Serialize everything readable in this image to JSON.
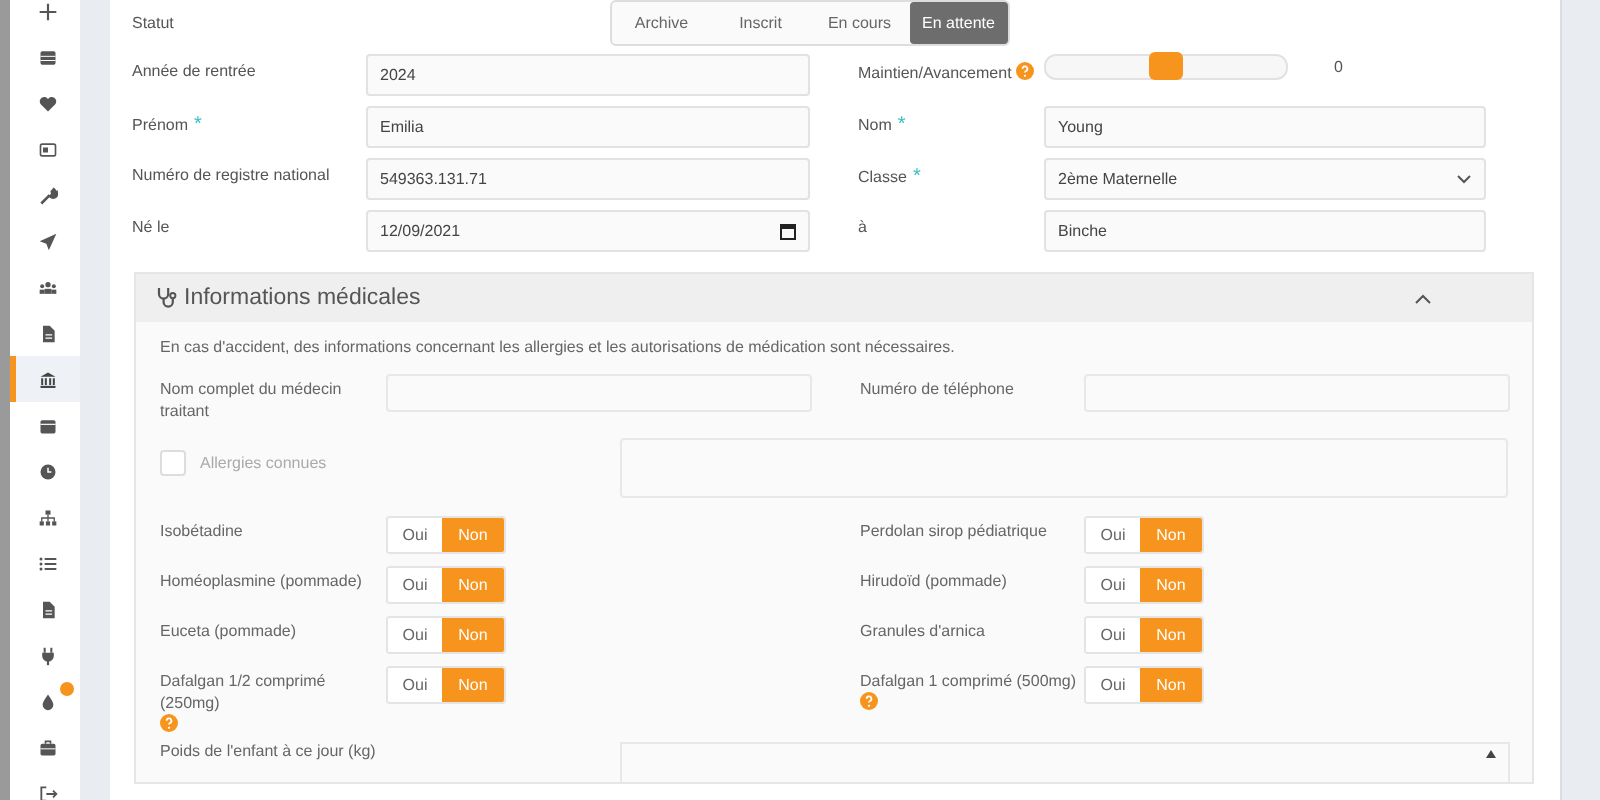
{
  "sidebar": {
    "items": [
      {
        "kind": "plus",
        "selected": false,
        "badge": false
      },
      {
        "kind": "table",
        "selected": false,
        "badge": false
      },
      {
        "kind": "heart",
        "selected": false,
        "badge": false
      },
      {
        "kind": "card",
        "selected": false,
        "badge": false
      },
      {
        "kind": "wrench",
        "selected": false,
        "badge": false
      },
      {
        "kind": "send",
        "selected": false,
        "badge": false
      },
      {
        "kind": "users",
        "selected": false,
        "badge": false
      },
      {
        "kind": "file",
        "selected": false,
        "badge": false
      },
      {
        "kind": "bank",
        "selected": true,
        "badge": false
      },
      {
        "kind": "calendar",
        "selected": false,
        "badge": false
      },
      {
        "kind": "clock",
        "selected": false,
        "badge": false
      },
      {
        "kind": "sitemap",
        "selected": false,
        "badge": false
      },
      {
        "kind": "list",
        "selected": false,
        "badge": false
      },
      {
        "kind": "file",
        "selected": false,
        "badge": false
      },
      {
        "kind": "plug",
        "selected": false,
        "badge": false
      },
      {
        "kind": "drop",
        "selected": false,
        "badge": true
      },
      {
        "kind": "briefcase",
        "selected": false,
        "badge": false
      },
      {
        "kind": "logout",
        "selected": false,
        "badge": false
      }
    ]
  },
  "status": {
    "label": "Statut",
    "options": [
      {
        "label": "Archive",
        "selected": false
      },
      {
        "label": "Inscrit",
        "selected": false
      },
      {
        "label": "En cours",
        "selected": false
      },
      {
        "label": "En attente",
        "selected": true
      }
    ]
  },
  "fields": [
    {
      "kind": "text",
      "label": "Année de rentrée",
      "value": "2024",
      "help": false
    },
    {
      "kind": "slider",
      "label": "Maintien/Avancement",
      "level": 0.5,
      "reading": "0",
      "help": true
    },
    {
      "kind": "text",
      "label": "Prénom",
      "required_mark": "*",
      "value": "Emilia",
      "help": false
    },
    {
      "kind": "text",
      "label": "Nom",
      "required_mark": "*",
      "value": "Young",
      "help": false
    },
    {
      "kind": "text",
      "label": "Numéro de registre national",
      "value": "549363.131.71",
      "help": false
    },
    {
      "kind": "select",
      "label": "Classe",
      "required_mark": "*",
      "value": "2ème Maternelle",
      "help": false
    },
    {
      "kind": "date",
      "label": "Né le",
      "value": "12/09/2021",
      "help": false
    },
    {
      "kind": "text",
      "label": "à",
      "value": "Binche",
      "help": false
    }
  ],
  "medical": {
    "title": "Informations médicales",
    "expanded": true,
    "notice": "En cas d'accident, des informations concernant les allergies et les autorisations de médication sont nécessaires.",
    "doctor_label": "Nom complet du médecin traitant",
    "phone_label": "Numéro de téléphone",
    "allergies": {
      "label": "Allergies connues",
      "checked": false
    },
    "medications": [
      {
        "name": "Isobétadine",
        "help": false,
        "choices": [
          {
            "label": "Oui",
            "selected": false
          },
          {
            "label": "Non",
            "selected": true
          }
        ]
      },
      {
        "name": "Perdolan sirop pédiatrique",
        "help": false,
        "choices": [
          {
            "label": "Oui",
            "selected": false
          },
          {
            "label": "Non",
            "selected": true
          }
        ]
      },
      {
        "name": "Homéoplasmine (pommade)",
        "help": false,
        "choices": [
          {
            "label": "Oui",
            "selected": false
          },
          {
            "label": "Non",
            "selected": true
          }
        ]
      },
      {
        "name": "Hirudoïd (pommade)",
        "help": false,
        "choices": [
          {
            "label": "Oui",
            "selected": false
          },
          {
            "label": "Non",
            "selected": true
          }
        ]
      },
      {
        "name": "Euceta (pommade)",
        "help": false,
        "choices": [
          {
            "label": "Oui",
            "selected": false
          },
          {
            "label": "Non",
            "selected": true
          }
        ]
      },
      {
        "name": "Granules d'arnica",
        "help": false,
        "choices": [
          {
            "label": "Oui",
            "selected": false
          },
          {
            "label": "Non",
            "selected": true
          }
        ]
      },
      {
        "name": "Dafalgan 1/2 comprimé (250mg)",
        "help": true,
        "choices": [
          {
            "label": "Oui",
            "selected": false
          },
          {
            "label": "Non",
            "selected": true
          }
        ]
      },
      {
        "name": "Dafalgan 1 comprimé (500mg)",
        "help": true,
        "choices": [
          {
            "label": "Oui",
            "selected": false
          },
          {
            "label": "Non",
            "selected": true
          }
        ]
      }
    ],
    "weight_label": "Poids de l'enfant à ce jour (kg)"
  }
}
